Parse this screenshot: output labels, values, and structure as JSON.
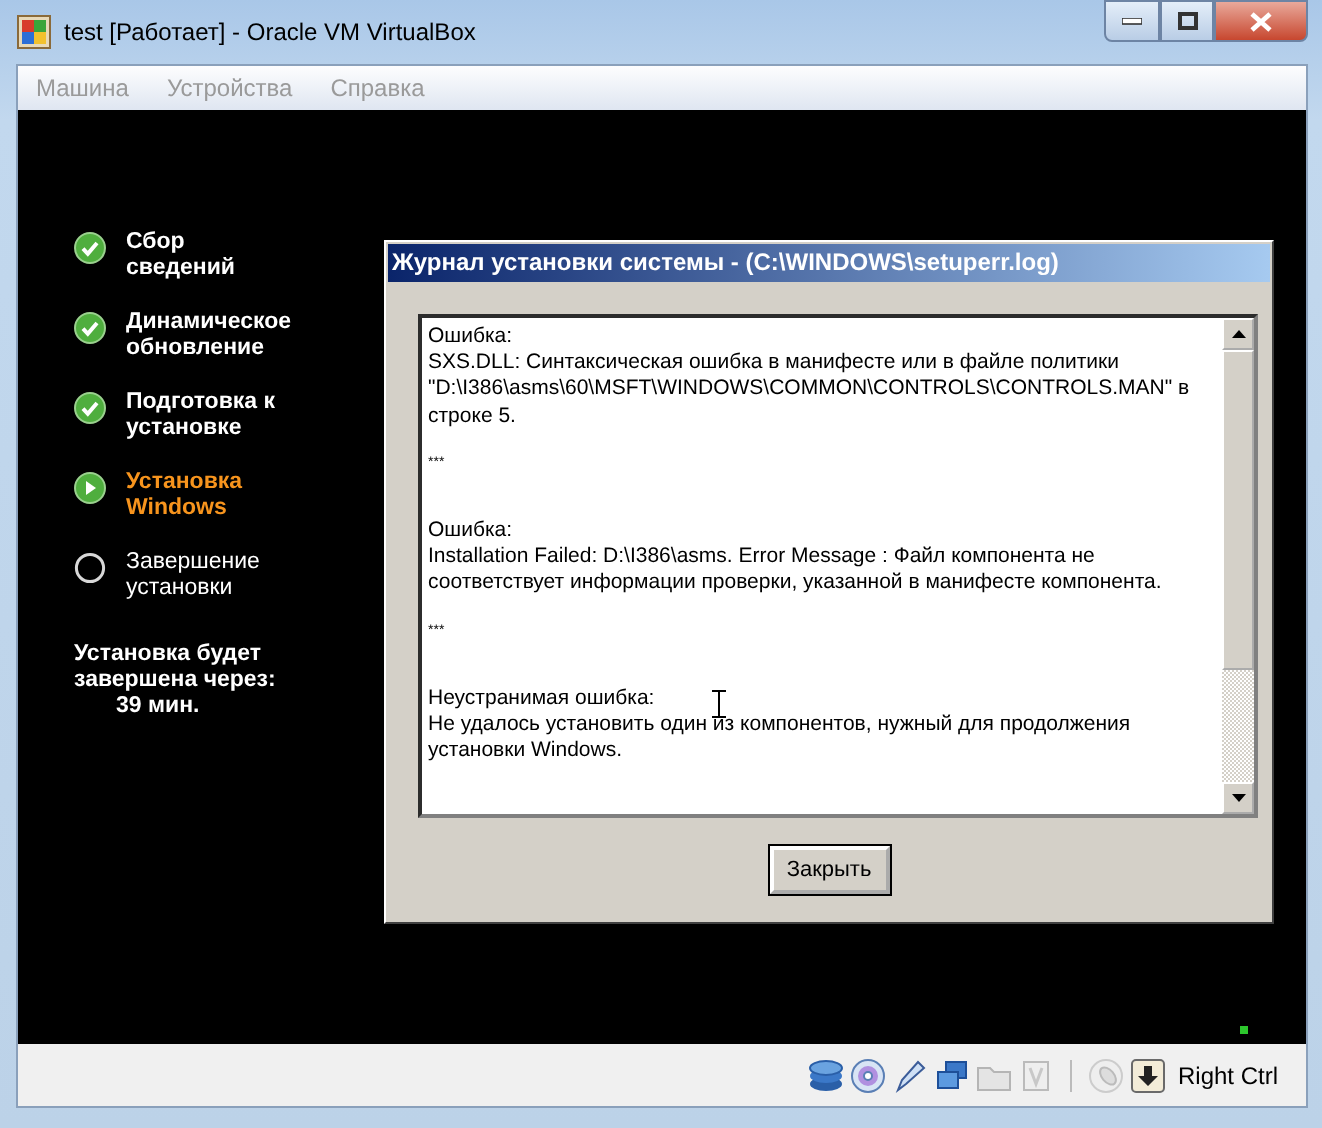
{
  "window": {
    "title": "test [Работает] - Oracle VM VirtualBox"
  },
  "menu": [
    "Машина",
    "Устройства",
    "Справка"
  ],
  "setup_steps": [
    {
      "lines": [
        "Сбор",
        "сведений"
      ],
      "kind": "done"
    },
    {
      "lines": [
        "Динамическое",
        "обновление"
      ],
      "kind": "done"
    },
    {
      "lines": [
        "Подготовка к",
        "установке"
      ],
      "kind": "done"
    },
    {
      "lines": [
        "Установка",
        "Windows"
      ],
      "kind": "current"
    },
    {
      "lines": [
        "Завершение",
        "установки"
      ],
      "kind": "pending"
    }
  ],
  "time_remaining": {
    "lines": [
      "Установка будет",
      "завершена через:"
    ],
    "value": "39 мин."
  },
  "log_dialog": {
    "title": "Журнал установки системы - (C:\\WINDOWS\\setuperr.log)",
    "blocks": [
      {
        "kind": "entry",
        "lines": [
          "Ошибка:",
          "SXS.DLL: Синтаксическая ошибка в манифесте или в файле политики \"D:\\I386\\asms\\60\\MSFT\\WINDOWS\\COMMON\\CONTROLS\\CONTROLS.MAN\" в строке 5."
        ]
      },
      {
        "kind": "separator",
        "lines": [
          "***"
        ]
      },
      {
        "kind": "entry",
        "lines": [
          "Ошибка:",
          "Installation Failed: D:\\I386\\asms. Error Message : Файл компонента не соответствует информации проверки, указанной в манифесте компонента."
        ]
      },
      {
        "kind": "separator",
        "lines": [
          "***"
        ]
      },
      {
        "kind": "entry",
        "lines": [
          "Неустранимая ошибка:",
          "Не удалось установить один из компонентов, нужный для продолжения установки Windows."
        ]
      }
    ],
    "close_button": "Закрыть"
  },
  "status_bar": {
    "host_key": "Right Ctrl"
  }
}
